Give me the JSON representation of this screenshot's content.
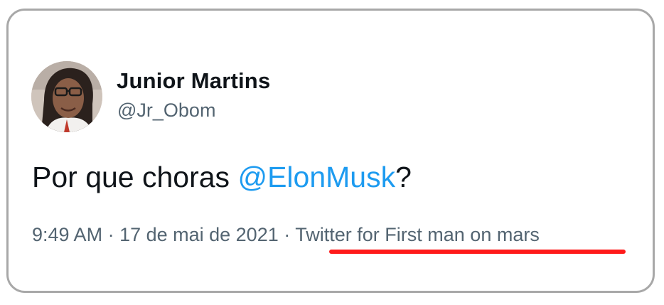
{
  "tweet": {
    "author": {
      "display_name": "Junior Martins",
      "handle": "@Jr_Obom"
    },
    "text_before": "Por que choras ",
    "mention": "@ElonMusk",
    "text_after": "?",
    "time": "9:49 AM",
    "separator": " · ",
    "date": "17 de mai de 2021",
    "source": "Twitter for First man on mars"
  },
  "colors": {
    "mention": "#1d9bf0",
    "underline": "#ff1a1a",
    "meta": "#536471",
    "text": "#0f1419"
  },
  "annotation": {
    "icon": "red-underline"
  }
}
